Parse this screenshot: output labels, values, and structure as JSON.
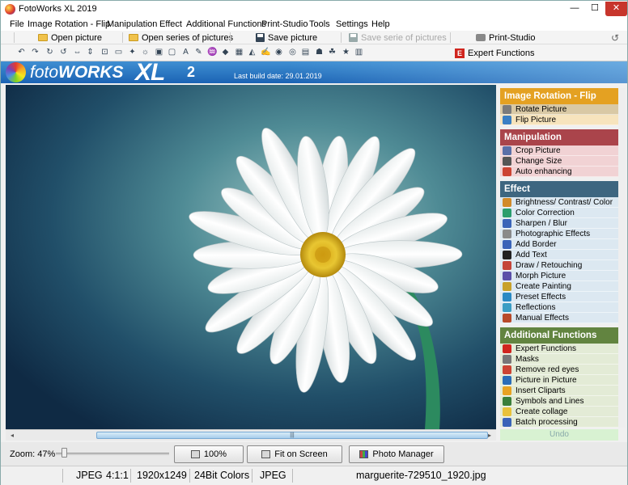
{
  "window": {
    "title": "FotoWorks XL 2019",
    "min": "—",
    "max": "☐",
    "close": "✕"
  },
  "menu": [
    "File",
    "Image Rotation - Flip",
    "Manipulation",
    "Effect",
    "Additional Functions",
    "Print-Studio",
    "Tools",
    "Settings",
    "Help"
  ],
  "quickbar": {
    "open_picture": "Open picture",
    "open_series": "Open series of pictures",
    "save_picture": "Save picture",
    "save_series": "Save serie of pictures",
    "print_studio": "Print-Studio",
    "undo_icon": "undo-icon"
  },
  "toolbar": {
    "icons": [
      "rotate-left-icon",
      "rotate-right-icon",
      "rotate-cw-icon",
      "rotate-ccw-icon",
      "flip-icon",
      "flip-vertical-icon",
      "crop-icon",
      "resize-icon",
      "auto-enhance-icon",
      "brightness-icon",
      "photo-effect-icon",
      "border-icon",
      "text-icon",
      "draw-icon",
      "paint-icon",
      "morph-icon",
      "preset-icon",
      "reflection-icon",
      "manual-effect-icon",
      "color-icon",
      "red-eye-icon",
      "picture-in-picture-icon",
      "clipart-icon",
      "symbol-icon",
      "star-icon",
      "batch-icon"
    ],
    "glyphs": [
      "↶",
      "↷",
      "↻",
      "↺",
      "⇔",
      "⇕",
      "⊡",
      "▭",
      "✦",
      "☼",
      "▣",
      "▢",
      "A",
      "✎",
      "♒",
      "◆",
      "▦",
      "◭",
      "✍",
      "◉",
      "◎",
      "▤",
      "☗",
      "☘",
      "★",
      "▥"
    ],
    "expert_functions": "Expert Functions"
  },
  "banner": {
    "logo_foto": "foto",
    "logo_works": "WORKS",
    "logo_xl": "XL",
    "logo_version": "2",
    "build": "Last build date: 29.01.2019"
  },
  "scroll": {
    "left": "◂",
    "right": "▸",
    "grip": "|||"
  },
  "bottom": {
    "zoom_label": "Zoom: 47%",
    "zoom_level": 0.05,
    "btn_100": "100%",
    "btn_fit": "Fit on Screen",
    "btn_manager": "Photo Manager"
  },
  "status": {
    "format": "JPEG",
    "sampling": "4:1:1",
    "dimensions": "1920x1249",
    "colors": "24Bit Colors",
    "type": "JPEG",
    "filename": "marguerite-729510_1920.jpg"
  },
  "panel": {
    "rotation": {
      "title": "Image Rotation - Flip",
      "items": [
        "Rotate Picture",
        "Flip Picture"
      ]
    },
    "manipulation": {
      "title": "Manipulation",
      "items": [
        "Crop Picture",
        "Change Size",
        "Auto enhancing"
      ]
    },
    "effect": {
      "title": "Effect",
      "items": [
        "Brightness/ Contrast/ Color",
        "Color Correction",
        "Sharpen / Blur",
        "Photographic Effects",
        "Add Border",
        "Add Text",
        "Draw / Retouching",
        "Morph Picture",
        "Create Painting",
        "Preset Effects",
        "Reflections",
        "Manual Effects"
      ]
    },
    "additional": {
      "title": "Additional Functions",
      "items": [
        "Expert Functions",
        "Masks",
        "Remove red eyes",
        "Picture in Picture",
        "Insert Cliparts",
        "Symbols and Lines",
        "Create collage",
        "Batch processing"
      ]
    },
    "undo": "Undo"
  },
  "colors": {
    "accent_blue": "#1b63b4",
    "rotation": "#e4a122",
    "manipulation": "#aa444b",
    "effect": "#3e6680",
    "additional": "#628440"
  }
}
